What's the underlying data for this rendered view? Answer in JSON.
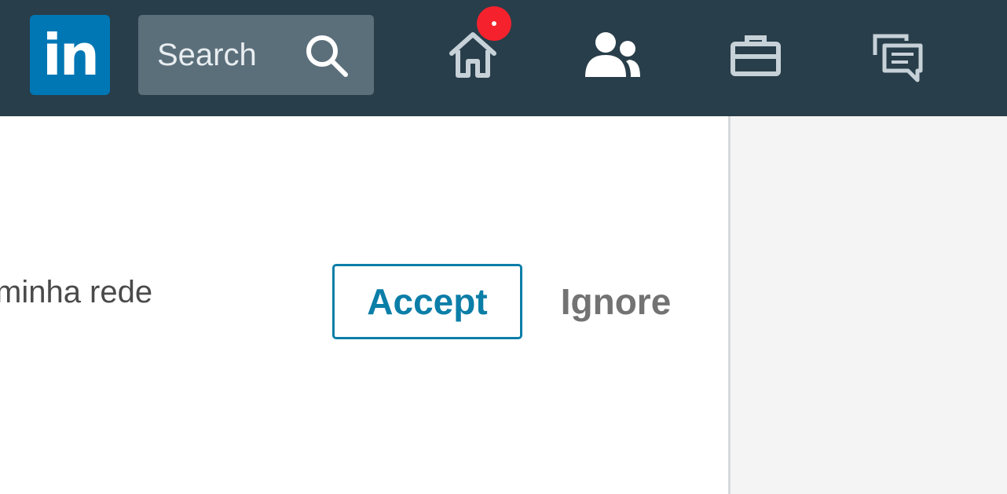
{
  "header": {
    "logo_text": "in",
    "search": {
      "label": "Search"
    },
    "nav": [
      {
        "id": "home",
        "icon": "home-icon",
        "has_notification": true
      },
      {
        "id": "network",
        "icon": "people-icon"
      },
      {
        "id": "jobs",
        "icon": "briefcase-icon"
      },
      {
        "id": "messaging",
        "icon": "messaging-icon"
      }
    ]
  },
  "invitation": {
    "text": "minha rede",
    "accept_label": "Accept",
    "ignore_label": "Ignore"
  },
  "colors": {
    "topbar": "#283e4a",
    "brand": "#0077b5",
    "accent": "#0b7ea8",
    "badge": "#f5222d",
    "icon": "#c7d1d8"
  }
}
